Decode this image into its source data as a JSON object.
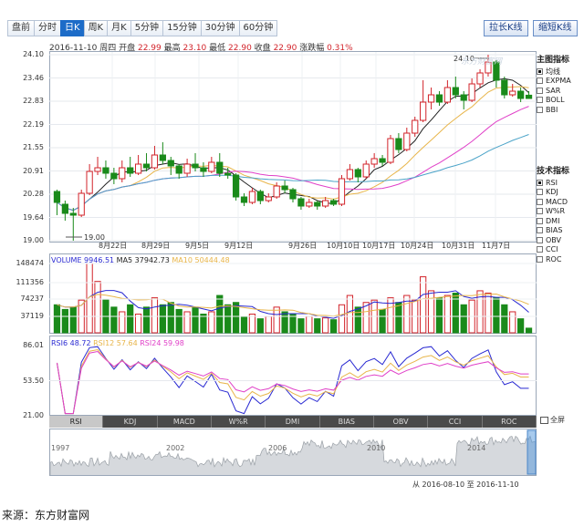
{
  "tabs": [
    "盘前",
    "分时",
    "日K",
    "周K",
    "月K",
    "5分钟",
    "15分钟",
    "30分钟",
    "60分钟"
  ],
  "active_tab": 2,
  "buttons": {
    "stretch": "拉长K线",
    "shorten": "缩短K线"
  },
  "info": {
    "date": "2016-11-10",
    "weekday": "周四",
    "open_label": "开盘",
    "open": "22.99",
    "high_label": "最高",
    "high": "23.10",
    "low_label": "最低",
    "low": "22.90",
    "close_label": "收盘",
    "close": "22.90",
    "change_label": "涨跌幅",
    "change": "0.31%"
  },
  "price_axis": [
    "24.10",
    "23.46",
    "22.83",
    "22.19",
    "21.55",
    "20.91",
    "20.28",
    "19.64",
    "19.00"
  ],
  "price_annotations": {
    "max": "24.10",
    "min": "19.00"
  },
  "x_labels": [
    "8月22日",
    "8月29日",
    "9月5日",
    "9月12日",
    "9月26日",
    "10月10日",
    "10月17日",
    "10月24日",
    "10月31日",
    "11月7日"
  ],
  "volume_axis": [
    "148474",
    "111356",
    "74237",
    "37119"
  ],
  "volume_legend": {
    "vol": "VOLUME 9946.51",
    "ma5": "MA5 37942.73",
    "ma10": "MA10 50444.48"
  },
  "rsi_axis": [
    "86.01",
    "53.50",
    "21.00"
  ],
  "rsi_legend": {
    "rsi6": "RSI6 48.72",
    "rsi12": "RSI12 57.64",
    "rsi24": "RSI24 59.98"
  },
  "main_indicators": {
    "title": "主图指标",
    "items": [
      {
        "label": "均线",
        "checked": true
      },
      {
        "label": "EXPMA",
        "checked": false
      },
      {
        "label": "SAR",
        "checked": false
      },
      {
        "label": "BOLL",
        "checked": false
      },
      {
        "label": "BBI",
        "checked": false
      }
    ]
  },
  "tech_indicators": {
    "title": "技术指标",
    "items": [
      {
        "label": "RSI",
        "checked": true
      },
      {
        "label": "KDJ",
        "checked": false
      },
      {
        "label": "MACD",
        "checked": false
      },
      {
        "label": "W%R",
        "checked": false
      },
      {
        "label": "DMI",
        "checked": false
      },
      {
        "label": "BIAS",
        "checked": false
      },
      {
        "label": "OBV",
        "checked": false
      },
      {
        "label": "CCI",
        "checked": false
      },
      {
        "label": "ROC",
        "checked": false
      }
    ]
  },
  "indicator_tabs": [
    "RSI",
    "KDJ",
    "MACD",
    "W%R",
    "DMI",
    "BIAS",
    "OBV",
    "CCI",
    "ROC"
  ],
  "active_indicator": 0,
  "fullscreen_label": "全屏",
  "overview_years": [
    "1997",
    "2002",
    "2006",
    "2010",
    "2014"
  ],
  "range": {
    "from_label": "从",
    "from": "2016-08-10",
    "to_label": "至",
    "to": "2016-11-10"
  },
  "source": "来源：东方财富网",
  "watermark": "东方财富网",
  "colors": {
    "up": "#d2232a",
    "down": "#1a8a1a",
    "ma5": "#222222",
    "ma10": "#e8b54a",
    "ma20": "#e040c8",
    "ma30": "#4aa3c8"
  },
  "chart_data": {
    "type": "candlestick",
    "candles": [
      [
        20.35,
        20.05,
        20.4,
        19.7
      ],
      [
        20.0,
        19.75,
        20.1,
        19.55
      ],
      [
        19.75,
        19.7,
        19.9,
        19.0
      ],
      [
        19.7,
        20.3,
        20.4,
        19.65
      ],
      [
        20.3,
        20.9,
        21.1,
        20.25
      ],
      [
        20.9,
        21.0,
        21.3,
        20.8
      ],
      [
        21.0,
        20.85,
        21.2,
        20.7
      ],
      [
        20.85,
        20.7,
        21.0,
        20.55
      ],
      [
        20.7,
        21.0,
        21.2,
        20.6
      ],
      [
        21.0,
        20.85,
        21.3,
        20.75
      ],
      [
        20.85,
        21.1,
        21.35,
        20.8
      ],
      [
        21.1,
        21.0,
        21.4,
        20.9
      ],
      [
        21.0,
        21.35,
        21.6,
        20.95
      ],
      [
        21.35,
        21.2,
        21.7,
        21.1
      ],
      [
        21.2,
        21.05,
        21.3,
        20.8
      ],
      [
        21.05,
        20.85,
        21.1,
        20.7
      ],
      [
        20.85,
        21.1,
        21.25,
        20.75
      ],
      [
        21.1,
        21.0,
        21.4,
        20.9
      ],
      [
        21.0,
        20.9,
        21.15,
        20.75
      ],
      [
        20.9,
        21.15,
        21.3,
        20.85
      ],
      [
        21.15,
        20.85,
        21.4,
        20.75
      ],
      [
        20.85,
        20.8,
        21.0,
        20.7
      ],
      [
        20.8,
        20.2,
        20.85,
        20.1
      ],
      [
        20.2,
        20.05,
        20.3,
        19.95
      ],
      [
        20.05,
        20.35,
        20.45,
        20.0
      ],
      [
        20.35,
        20.1,
        20.4,
        20.0
      ],
      [
        20.1,
        20.2,
        20.3,
        20.05
      ],
      [
        20.2,
        20.5,
        20.6,
        20.15
      ],
      [
        20.5,
        20.4,
        20.65,
        20.3
      ],
      [
        20.4,
        20.15,
        20.45,
        20.05
      ],
      [
        20.15,
        19.95,
        20.2,
        19.85
      ],
      [
        19.95,
        20.05,
        20.15,
        19.9
      ],
      [
        20.05,
        19.95,
        20.1,
        19.85
      ],
      [
        19.95,
        20.1,
        20.2,
        19.9
      ],
      [
        20.1,
        20.0,
        20.15,
        19.95
      ],
      [
        20.0,
        20.7,
        20.8,
        19.95
      ],
      [
        20.7,
        20.95,
        21.1,
        20.65
      ],
      [
        20.95,
        20.75,
        21.0,
        20.6
      ],
      [
        20.75,
        21.1,
        21.2,
        20.7
      ],
      [
        21.1,
        21.25,
        21.4,
        21.0
      ],
      [
        21.25,
        21.15,
        21.35,
        21.05
      ],
      [
        21.15,
        21.8,
        21.9,
        21.1
      ],
      [
        21.8,
        21.5,
        21.95,
        21.4
      ],
      [
        21.5,
        21.95,
        22.1,
        21.45
      ],
      [
        21.95,
        22.3,
        22.4,
        21.85
      ],
      [
        22.3,
        22.8,
        23.4,
        22.25
      ],
      [
        22.8,
        23.0,
        23.2,
        22.6
      ],
      [
        23.0,
        22.8,
        23.1,
        22.7
      ],
      [
        22.8,
        23.2,
        23.4,
        22.75
      ],
      [
        23.2,
        23.0,
        23.5,
        22.9
      ],
      [
        23.0,
        22.85,
        23.1,
        22.6
      ],
      [
        22.85,
        23.3,
        23.45,
        22.8
      ],
      [
        23.3,
        23.6,
        23.7,
        23.2
      ],
      [
        23.6,
        23.9,
        24.1,
        23.5
      ],
      [
        23.9,
        23.4,
        23.95,
        23.2
      ],
      [
        23.4,
        23.0,
        23.5,
        22.9
      ],
      [
        23.0,
        23.1,
        23.3,
        22.95
      ],
      [
        23.1,
        22.9,
        23.2,
        22.8
      ],
      [
        22.99,
        22.9,
        23.1,
        22.9
      ]
    ],
    "volume": [
      60000,
      50000,
      55000,
      70000,
      148474,
      110000,
      70000,
      55000,
      45000,
      60000,
      40000,
      55000,
      75000,
      60000,
      65000,
      50000,
      45000,
      55000,
      40000,
      45000,
      80000,
      60000,
      65000,
      35000,
      40000,
      30000,
      35000,
      55000,
      45000,
      40000,
      30000,
      35000,
      30000,
      32000,
      28000,
      60000,
      80000,
      55000,
      65000,
      70000,
      50000,
      75000,
      65000,
      80000,
      70000,
      120000,
      90000,
      75000,
      80000,
      85000,
      60000,
      70000,
      90000,
      85000,
      75000,
      60000,
      45000,
      30000,
      9946
    ],
    "volume_up": [
      false,
      false,
      false,
      true,
      true,
      true,
      false,
      false,
      true,
      false,
      true,
      false,
      true,
      false,
      false,
      false,
      true,
      false,
      false,
      true,
      false,
      false,
      false,
      false,
      true,
      false,
      true,
      true,
      false,
      false,
      false,
      true,
      false,
      true,
      false,
      true,
      true,
      false,
      true,
      true,
      false,
      true,
      false,
      true,
      true,
      true,
      true,
      false,
      true,
      false,
      false,
      true,
      true,
      true,
      false,
      false,
      true,
      false,
      false
    ],
    "ylim": [
      19.0,
      24.1
    ],
    "vol_ylim": [
      0,
      148474
    ],
    "rsi_ylim": [
      21.0,
      86.01
    ]
  }
}
